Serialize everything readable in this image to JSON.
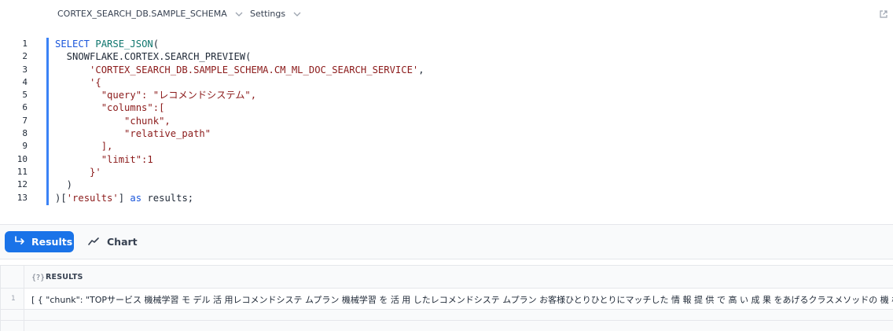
{
  "toolbar": {
    "context_label": "CORTEX_SEARCH_DB.SAMPLE_SCHEMA",
    "settings_label": "Settings"
  },
  "editor": {
    "line_numbers": [
      "1",
      "2",
      "3",
      "4",
      "5",
      "6",
      "7",
      "8",
      "9",
      "10",
      "11",
      "12",
      "13"
    ],
    "lines": [
      [
        {
          "t": "kw",
          "v": "SELECT"
        },
        {
          "t": "",
          "v": " "
        },
        {
          "t": "fn",
          "v": "PARSE_JSON"
        },
        {
          "t": "",
          "v": "("
        }
      ],
      [
        {
          "t": "",
          "v": "  SNOWFLAKE.CORTEX.SEARCH_PREVIEW("
        }
      ],
      [
        {
          "t": "",
          "v": "      "
        },
        {
          "t": "st",
          "v": "'CORTEX_SEARCH_DB.SAMPLE_SCHEMA.CM_ML_DOC_SEARCH_SERVICE'"
        },
        {
          "t": "",
          "v": ","
        }
      ],
      [
        {
          "t": "",
          "v": "      "
        },
        {
          "t": "st",
          "v": "'{"
        }
      ],
      [
        {
          "t": "st",
          "v": "        \"query\": \"レコメンドシステム\","
        }
      ],
      [
        {
          "t": "st",
          "v": "        \"columns\":["
        }
      ],
      [
        {
          "t": "st",
          "v": "            \"chunk\","
        }
      ],
      [
        {
          "t": "st",
          "v": "            \"relative_path\""
        }
      ],
      [
        {
          "t": "st",
          "v": "        ],"
        }
      ],
      [
        {
          "t": "st",
          "v": "        \"limit\":1"
        }
      ],
      [
        {
          "t": "st",
          "v": "      }'"
        }
      ],
      [
        {
          "t": "",
          "v": "  )"
        }
      ],
      [
        {
          "t": "",
          "v": ")["
        },
        {
          "t": "st",
          "v": "'results'"
        },
        {
          "t": "",
          "v": "] "
        },
        {
          "t": "kw",
          "v": "as"
        },
        {
          "t": "",
          "v": " results;"
        }
      ]
    ]
  },
  "tabs": {
    "results_label": "Results",
    "chart_label": "Chart"
  },
  "grid": {
    "type_badge": "{?}",
    "column_header": "RESULTS",
    "rows": [
      {
        "num": "1",
        "value": "[ {   \"chunk\": \"TOPサービス 機械学習 モ デル 活 用レコメンドシステ ムプラン 機械学習 を 活 用 したレコメンドシステ ムプラン お客様ひとりひとりにマッチした 情 報 提 供 で 高 い 成 果 をあげるクラスメソッドの 機 械 学 習"
      }
    ]
  }
}
